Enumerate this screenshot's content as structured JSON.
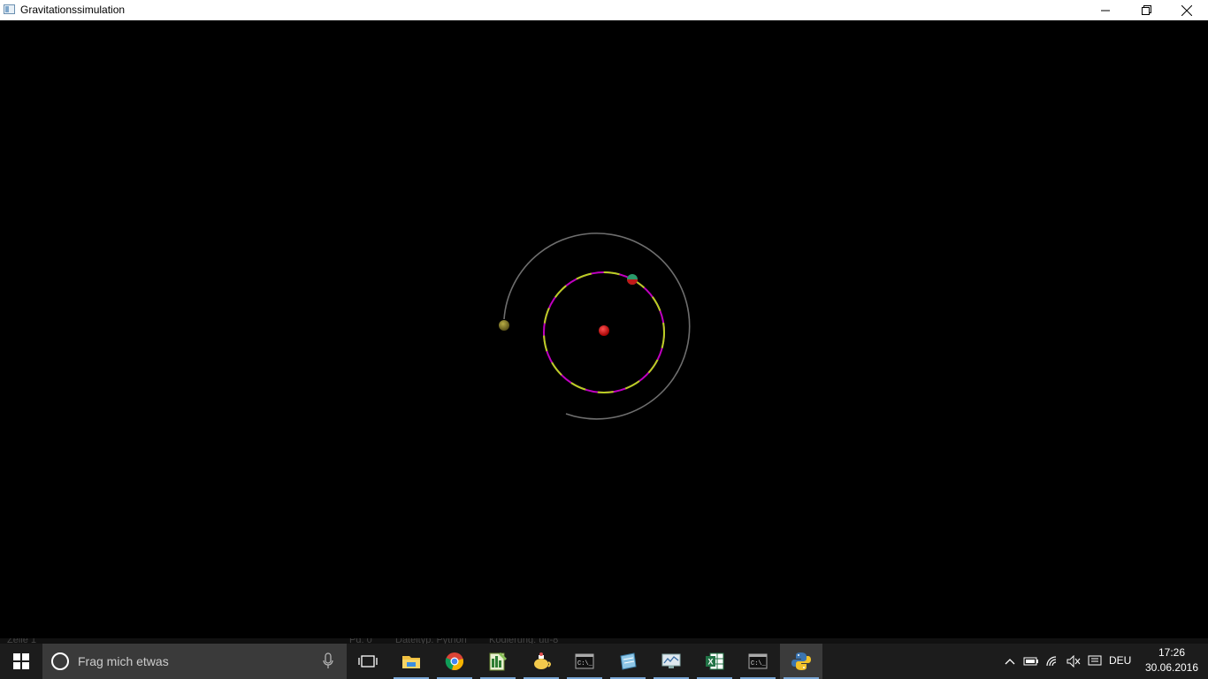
{
  "window": {
    "title": "Gravitationssimulation"
  },
  "background_strip": {
    "left_text": "Zeile 1",
    "mid_text": "Pd: 0",
    "type_text": "Dateityp: Python",
    "enc_text": "Kodierung: utf-8"
  },
  "taskbar": {
    "search_placeholder": "Frag mich etwas",
    "apps": [
      {
        "icon": "task-view-icon"
      },
      {
        "icon": "file-explorer-icon"
      },
      {
        "icon": "chrome-icon"
      },
      {
        "icon": "notepad-plus-icon"
      },
      {
        "icon": "tea-app-icon"
      },
      {
        "icon": "cmd-icon"
      },
      {
        "icon": "blueprint-icon"
      },
      {
        "icon": "monitor-icon"
      },
      {
        "icon": "excel-icon"
      },
      {
        "icon": "cmd-icon"
      },
      {
        "icon": "python-icon"
      }
    ],
    "language": "DEU",
    "time": "17:26",
    "date": "30.06.2016"
  },
  "simulation": {
    "colors": {
      "sun": "#d40000",
      "inner_orbit_a": "#c000c0",
      "inner_orbit_b": "#b8d020",
      "outer_orbit": "#6e6e6e",
      "planet_inner": "#2a9a6a",
      "planet_outer": "#8a8028"
    }
  }
}
